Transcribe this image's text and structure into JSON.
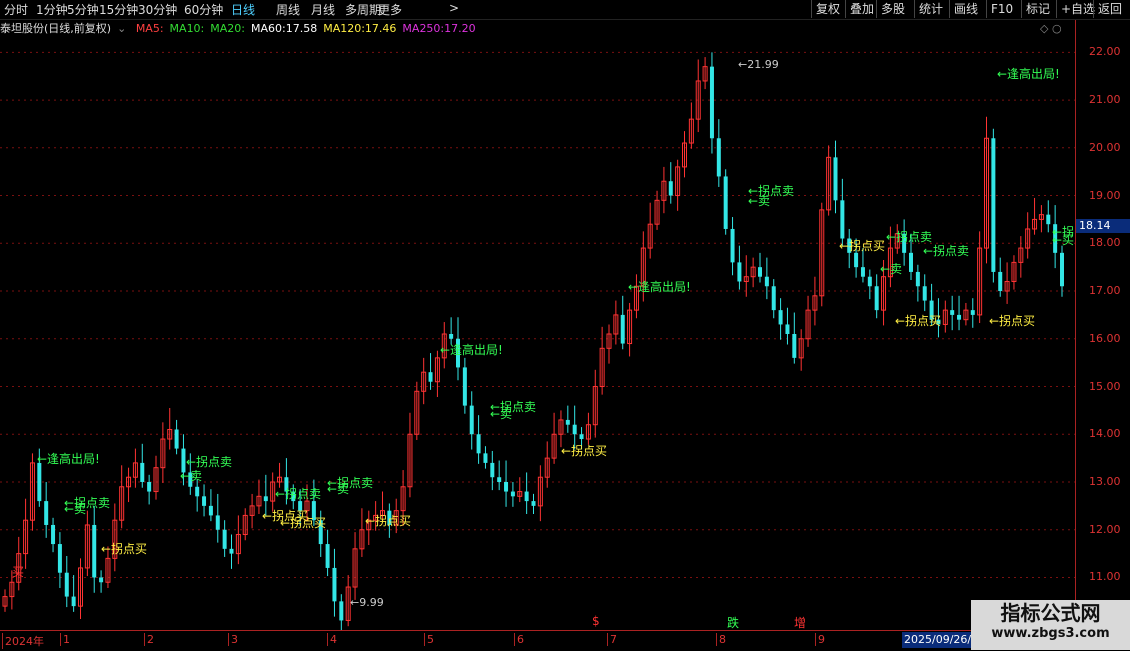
{
  "periods": [
    "分时",
    "1分钟",
    "5分钟",
    "15分钟",
    "30分钟",
    "60分钟",
    "日线",
    "周线",
    "月线",
    "多周期",
    "更多"
  ],
  "active_period": "日线",
  "more_suffix": ">",
  "tools": [
    "复权",
    "叠加",
    "多股",
    "统计",
    "画线",
    "F10",
    "标记",
    "+自选",
    "返回"
  ],
  "stock_name": "泰坦股份(日线,前复权)",
  "ma": [
    {
      "label": "MA5:",
      "value": "",
      "color": "#ff4040"
    },
    {
      "label": "MA10:",
      "value": "",
      "color": "#33dd33"
    },
    {
      "label": "MA20:",
      "value": "",
      "color": "#33dd33"
    },
    {
      "label": "MA60:",
      "value": "17.58",
      "color": "#ffffff"
    },
    {
      "label": "MA120:",
      "value": "17.46",
      "color": "#ffee44"
    },
    {
      "label": "MA250:",
      "value": "17.20",
      "color": "#dd33dd"
    }
  ],
  "last_price": "18.14",
  "axis_ticks": [
    "22.00",
    "21.00",
    "20.00",
    "19.00",
    "18.00",
    "17.00",
    "16.00",
    "15.00",
    "14.00",
    "13.00",
    "12.00",
    "11.00"
  ],
  "months": [
    "2024年",
    "1",
    "2",
    "3",
    "4",
    "5",
    "6",
    "7",
    "8",
    "9"
  ],
  "date_box": "2025/09/26/五",
  "events": [
    {
      "text": "$",
      "color": "#ff3333"
    },
    {
      "text": "跌",
      "color": "#33ff55"
    },
    {
      "text": "增",
      "color": "#ff3333"
    }
  ],
  "extremes": {
    "high": "21.99",
    "low": "9.99"
  },
  "signals": {
    "escape": "←逢高出局!",
    "turn_sell": "←拐点卖",
    "turn_buy": "←拐点买",
    "sell": "←卖",
    "buy": "←买",
    "buy_plain": "买",
    "turn_sell_short": "←拐",
    "buy_short": "←买"
  },
  "watermark": {
    "title": "指标公式网",
    "url": "www.zbgs3.com"
  },
  "chart_data": {
    "type": "candlestick",
    "ylim": [
      9.9,
      22.3
    ],
    "grid": true,
    "y_ticks": [
      22,
      21,
      20,
      19,
      18,
      17,
      16,
      15,
      14,
      13,
      12,
      11
    ],
    "x_months": [
      "2024年",
      "1",
      "2",
      "3",
      "4",
      "5",
      "6",
      "7",
      "8",
      "9"
    ],
    "series": [
      {
        "values": [
          10.6,
          10.9,
          11.5,
          12.2,
          13.4,
          12.6,
          12.1,
          11.7,
          11.1,
          10.6,
          10.4,
          11.2,
          12.1,
          11.0,
          10.9,
          11.4,
          12.2,
          12.9,
          13.1,
          13.4,
          13.0,
          12.8,
          13.3,
          13.9,
          14.1,
          13.7,
          13.2,
          12.9,
          12.7,
          12.5,
          12.3,
          12.0,
          11.6,
          11.5,
          11.9,
          12.3,
          12.5,
          12.7,
          12.6,
          13.0,
          13.1,
          12.8,
          12.6,
          12.4,
          12.6,
          12.2,
          11.7,
          11.2,
          10.5,
          10.1,
          10.8,
          11.6,
          12.0,
          12.2,
          12.3,
          12.4,
          12.1,
          12.4,
          12.9,
          14.0,
          14.9,
          15.3,
          15.1,
          15.6,
          16.1,
          16.0,
          15.4,
          14.6,
          14.0,
          13.6,
          13.4,
          13.1,
          13.0,
          12.8,
          12.7,
          12.8,
          12.6,
          12.5,
          13.1,
          13.5,
          14.0,
          14.3,
          14.2,
          14.0,
          13.9,
          14.2,
          15.0,
          15.8,
          16.1,
          16.5,
          15.9,
          16.6,
          17.1,
          17.9,
          18.4,
          18.9,
          19.3,
          19.0,
          19.6,
          20.1,
          20.6,
          21.4,
          21.7,
          20.2,
          19.4,
          18.3,
          17.6,
          17.2,
          17.3,
          17.5,
          17.3,
          17.1,
          16.6,
          16.3,
          16.1,
          15.6,
          16.0,
          16.6,
          16.9,
          18.7,
          19.8,
          18.9,
          18.1,
          17.8,
          17.5,
          17.3,
          17.1,
          16.6,
          17.3,
          17.9,
          18.2,
          17.8,
          17.4,
          17.1,
          16.8,
          16.4,
          16.3,
          16.6,
          16.5,
          16.4,
          16.6,
          16.5,
          17.9,
          20.2,
          17.4,
          17.0,
          17.2,
          17.6,
          17.9,
          18.3,
          18.5,
          18.6,
          18.4,
          17.8,
          17.1
        ]
      }
    ]
  }
}
